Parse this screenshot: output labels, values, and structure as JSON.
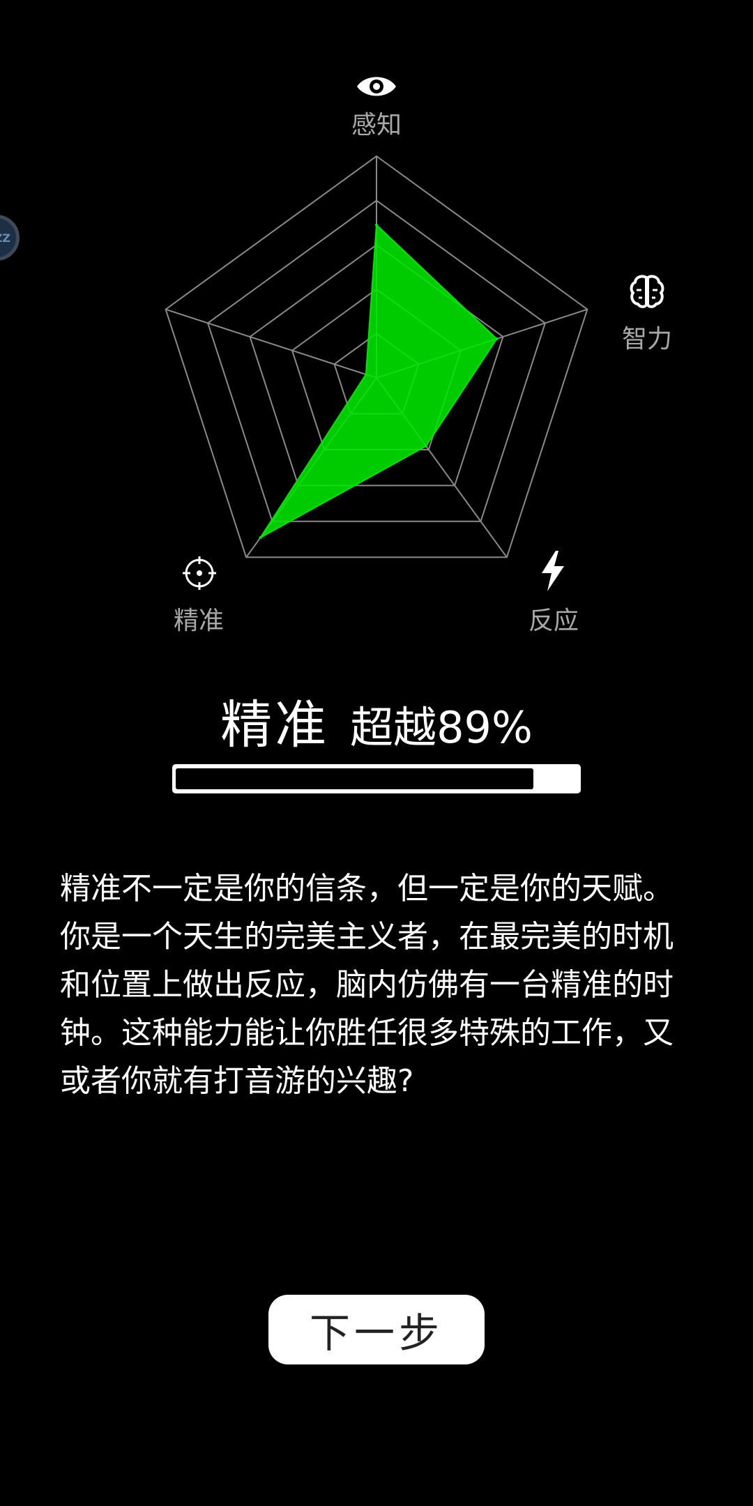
{
  "radar": {
    "axes": [
      {
        "label": "感知",
        "icon": "eye-icon"
      },
      {
        "label": "智力",
        "icon": "brain-icon"
      },
      {
        "label": "反应",
        "icon": "lightning-icon"
      },
      {
        "label": "精准",
        "icon": "crosshair-icon"
      }
    ],
    "colors": {
      "fill": "#00e600",
      "grid": "#8a8a8a"
    }
  },
  "chart_data": {
    "type": "radar",
    "categories": [
      "感知",
      "智力",
      "反应",
      "精准",
      "(unlabeled)"
    ],
    "values": [
      0.69,
      0.57,
      0.38,
      0.89,
      0.05
    ],
    "rings": 5,
    "range": [
      0,
      1
    ]
  },
  "result": {
    "dimension": "精准",
    "exceed_text": "超越89%",
    "progress": 0.89
  },
  "description": "精准不一定是你的信条，但一定是你的天赋。你是一个天生的完美主义者，在最完美的时机和位置上做出反应，脑内仿佛有一台精准的时钟。这种能力能让你胜任很多特殊的工作，又或者你就有打音游的兴趣?",
  "next_button": {
    "label": "下一步"
  },
  "float_ball": {
    "label": "ZZ"
  }
}
